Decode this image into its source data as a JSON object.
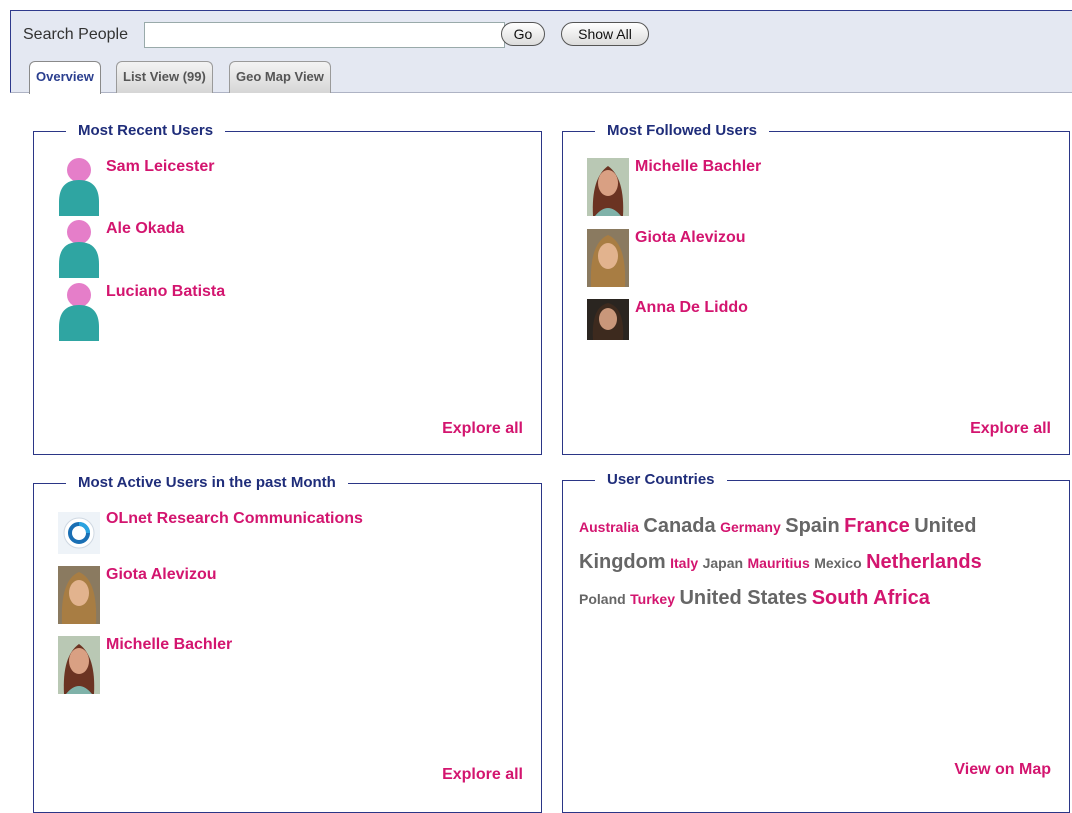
{
  "search": {
    "label": "Search People",
    "value": "",
    "placeholder": "",
    "go_label": "Go",
    "show_all_label": "Show All"
  },
  "tabs": [
    {
      "label": "Overview",
      "active": true
    },
    {
      "label": "List View (99)",
      "active": false
    },
    {
      "label": "Geo Map View",
      "active": false
    }
  ],
  "panels": {
    "recent": {
      "title": "Most Recent Users",
      "users": [
        "Sam Leicester",
        "Ale Okada",
        "Luciano Batista"
      ],
      "link": "Explore all"
    },
    "followed": {
      "title": "Most Followed Users",
      "users": [
        "Michelle Bachler",
        "Giota Alevizou",
        "Anna De Liddo"
      ],
      "link": "Explore all"
    },
    "active": {
      "title": "Most Active Users in the past Month",
      "users": [
        "OLnet Research Communications",
        "Giota Alevizou",
        "Michelle Bachler"
      ],
      "link": "Explore all"
    },
    "countries": {
      "title": "User Countries",
      "list": [
        {
          "name": "Australia",
          "color": "#d3156f",
          "size": 14
        },
        {
          "name": "Canada",
          "color": "#666666",
          "size": 20
        },
        {
          "name": "Germany",
          "color": "#d3156f",
          "size": 14
        },
        {
          "name": "Spain",
          "color": "#666666",
          "size": 20
        },
        {
          "name": "France",
          "color": "#d3156f",
          "size": 20
        },
        {
          "name": "United Kingdom",
          "color": "#666666",
          "size": 20
        },
        {
          "name": "Italy",
          "color": "#d3156f",
          "size": 14
        },
        {
          "name": "Japan",
          "color": "#666666",
          "size": 14
        },
        {
          "name": "Mauritius",
          "color": "#d3156f",
          "size": 14
        },
        {
          "name": "Mexico",
          "color": "#666666",
          "size": 14
        },
        {
          "name": "Netherlands",
          "color": "#d3156f",
          "size": 20
        },
        {
          "name": "Poland",
          "color": "#666666",
          "size": 14
        },
        {
          "name": "Turkey",
          "color": "#d3156f",
          "size": 14
        },
        {
          "name": "United States",
          "color": "#666666",
          "size": 20
        },
        {
          "name": "South Africa",
          "color": "#d3156f",
          "size": 20
        }
      ],
      "link": "View on Map"
    }
  },
  "colors": {
    "accent": "#d3156f",
    "heading": "#1f2d7a",
    "border": "#2b3686"
  }
}
